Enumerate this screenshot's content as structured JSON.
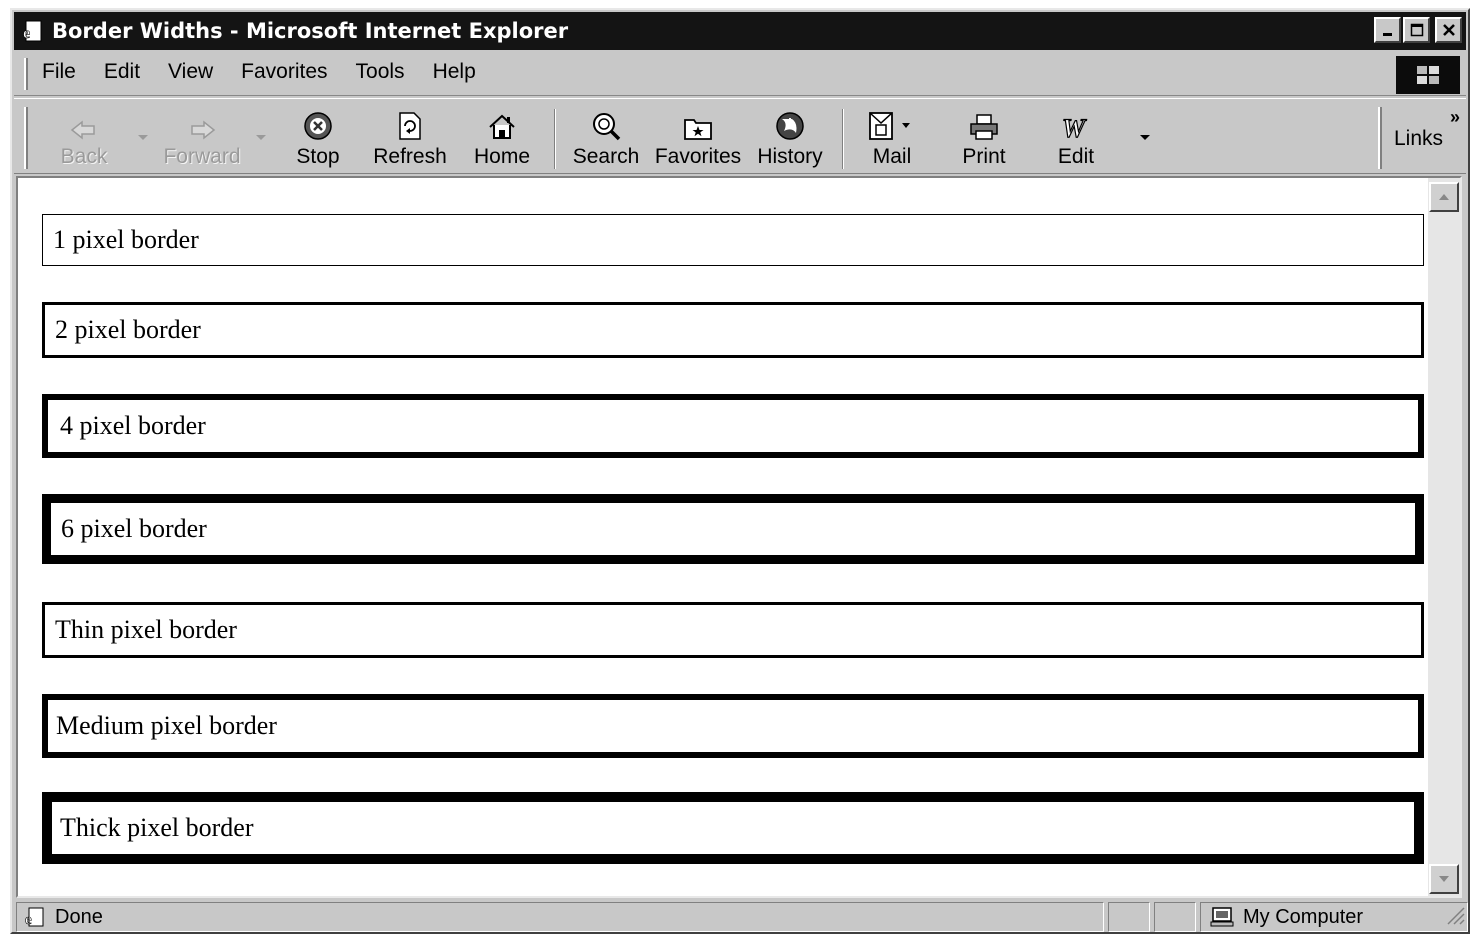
{
  "window": {
    "title": "Border Widths - Microsoft Internet Explorer"
  },
  "menu": [
    "File",
    "Edit",
    "View",
    "Favorites",
    "Tools",
    "Help"
  ],
  "toolbar": {
    "back": "Back",
    "forward": "Forward",
    "stop": "Stop",
    "refresh": "Refresh",
    "home": "Home",
    "search": "Search",
    "favorites": "Favorites",
    "history": "History",
    "mail": "Mail",
    "print": "Print",
    "edit": "Edit",
    "links": "Links",
    "more": "»"
  },
  "boxes": [
    {
      "label": "1 pixel border",
      "border_width": "1px"
    },
    {
      "label": "2 pixel border",
      "border_width": "2px"
    },
    {
      "label": "4 pixel border",
      "border_width": "4px"
    },
    {
      "label": "6 pixel border",
      "border_width": "6px"
    },
    {
      "label": "Thin pixel border",
      "border_width": "thin"
    },
    {
      "label": "Medium pixel border",
      "border_width": "medium"
    },
    {
      "label": "Thick pixel border",
      "border_width": "thick"
    }
  ],
  "status": {
    "text": "Done",
    "zone": "My Computer"
  },
  "colors": {
    "chrome": "#c8c8c8",
    "titlebar": "#141414",
    "page_background": "#ffffff",
    "border": "#000000"
  }
}
